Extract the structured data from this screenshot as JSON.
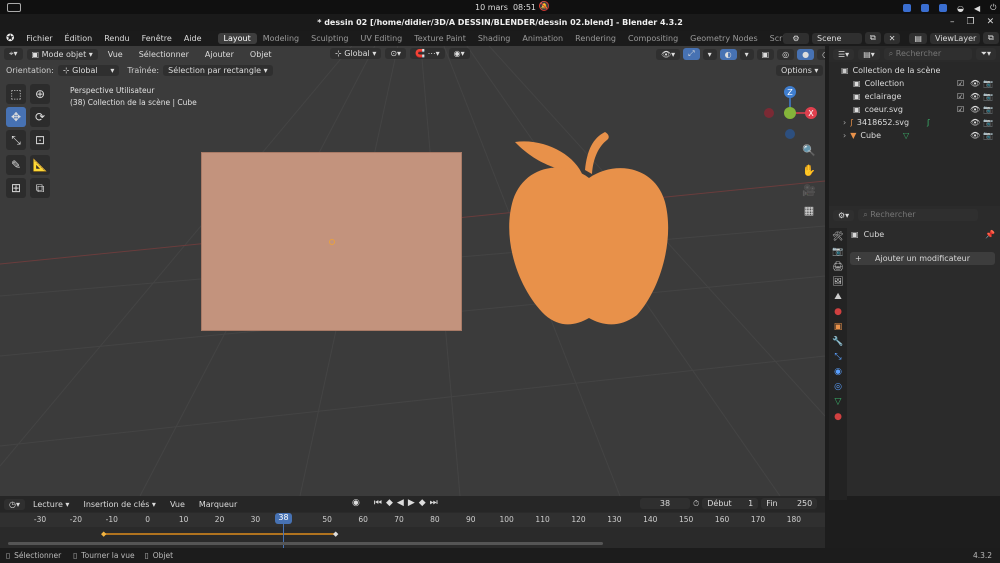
{
  "system": {
    "date": "10 mars",
    "time": "08:51"
  },
  "title": "* dessin 02 [/home/didier/3D/A DESSIN/BLENDER/dessin 02.blend] - Blender 4.3.2",
  "menu": [
    "Fichier",
    "Édition",
    "Rendu",
    "Fenêtre",
    "Aide"
  ],
  "workspaces": [
    "Layout",
    "Modeling",
    "Sculpting",
    "UV Editing",
    "Texture Paint",
    "Shading",
    "Animation",
    "Rendering",
    "Compositing",
    "Geometry Nodes",
    "Scripting"
  ],
  "workspace_add": "+",
  "scene": "Scene",
  "view_layer": "ViewLayer",
  "viewport_header": {
    "mode": "Mode objet",
    "items": [
      "Vue",
      "Sélectionner",
      "Ajouter",
      "Objet"
    ],
    "transform": "Global",
    "orientation_label": "Orientation:",
    "orientation_value": "Global",
    "drag_label": "Traînée:",
    "drag_value": "Sélection par rectangle",
    "options": "Options"
  },
  "viewport_info": {
    "line1": "Perspective Utilisateur",
    "line2": "(38) Collection de la scène | Cube"
  },
  "gizmo": {
    "z": "Z",
    "x": "X"
  },
  "outliner": {
    "search_placeholder": "Rechercher",
    "root": "Collection de la scène",
    "items": [
      {
        "label": "Collection"
      },
      {
        "label": "eclairage"
      },
      {
        "label": "coeur.svg"
      },
      {
        "label": "3418652.svg"
      },
      {
        "label": "Cube"
      }
    ]
  },
  "properties": {
    "search_placeholder": "Rechercher",
    "object": "Cube",
    "add_modifier": "Ajouter un modificateur"
  },
  "timeline": {
    "menus": [
      "Lecture",
      "Insertion de clés",
      "Vue",
      "Marqueur"
    ],
    "current_frame": "38",
    "start_label": "Début",
    "start_value": "1",
    "end_label": "Fin",
    "end_value": "250",
    "ticks": [
      "-30",
      "-20",
      "-10",
      "0",
      "10",
      "20",
      "30",
      "",
      "50",
      "60",
      "70",
      "80",
      "90",
      "100",
      "110",
      "120",
      "130",
      "140",
      "150",
      "160",
      "170",
      "180"
    ],
    "playhead": "38"
  },
  "status": {
    "select": "Sélectionner",
    "rotate": "Tourner la vue",
    "object": "Objet",
    "version": "4.3.2"
  },
  "colors": {
    "apple": "#e8914a",
    "plane": "#c3937d",
    "accent": "#4772b3",
    "x_axis": "#e0404e",
    "y_axis": "#84b43a",
    "z_axis": "#3f7ecf"
  }
}
